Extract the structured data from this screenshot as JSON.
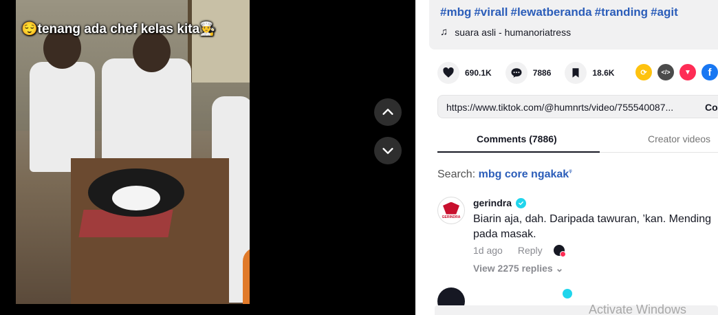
{
  "video": {
    "caption": "😌tenang ada chef kelas kita👨‍🍳"
  },
  "nav": {
    "up_icon": "chevron-up-icon",
    "down_icon": "chevron-down-icon"
  },
  "description": {
    "hashtags": [
      "#mbg",
      "#virall",
      "#lewatberanda",
      "#tranding",
      "#agit"
    ],
    "music_icon": "♫",
    "music": "suara asli - humanoriatress"
  },
  "actions": {
    "likes": "690.1K",
    "comments": "7886",
    "saves": "18.6K"
  },
  "share": {
    "icons": [
      {
        "name": "repost-icon",
        "color": "#fec20f",
        "glyph": "⟳"
      },
      {
        "name": "embed-icon",
        "color": "#4b4b4b",
        "glyph": "</>"
      },
      {
        "name": "send-icon",
        "color": "#fe2c55",
        "glyph": "▼"
      },
      {
        "name": "facebook-icon",
        "color": "#1877f2",
        "glyph": "f"
      }
    ]
  },
  "link": {
    "url": "https://www.tiktok.com/@humnrts/video/755540087...",
    "copy_label": "Co"
  },
  "tabs": {
    "comments": "Comments (7886)",
    "creator": "Creator videos"
  },
  "search": {
    "label": "Search:",
    "term": "mbg core ngakak",
    "icon": "ᵠ"
  },
  "comment": {
    "avatar_text": "GERINDRA",
    "user": "gerindra",
    "text": "Biarin aja, dah. Daripada tawuran, ’kan. Mending pada masak.",
    "time": "1d ago",
    "reply": "Reply",
    "view_replies": "View 2275 replies ⌄"
  },
  "watermark": "Activate Windows",
  "colors": {
    "link_blue": "#2b5db9",
    "verified": "#20d5ec",
    "accent": "#fe2c55"
  }
}
